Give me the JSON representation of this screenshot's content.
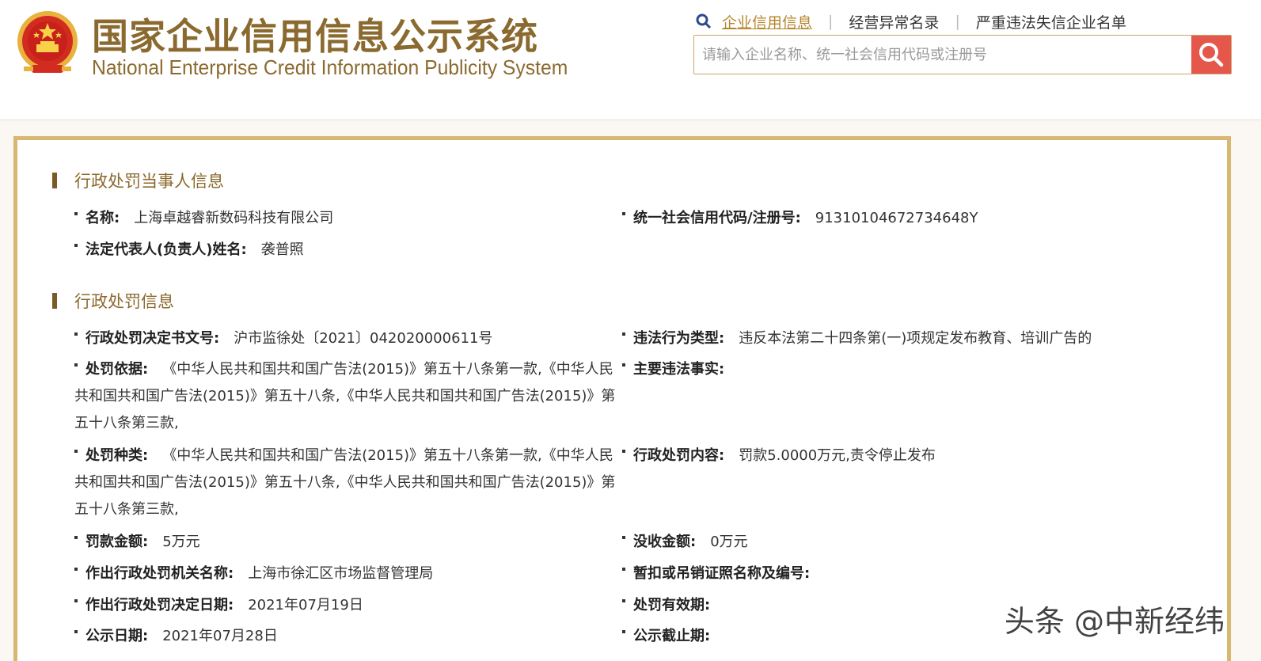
{
  "header": {
    "title_cn": "国家企业信用信息公示系统",
    "title_en": "National Enterprise Credit Information Publicity System",
    "nav": [
      {
        "label": "企业信用信息"
      },
      {
        "label": "经营异常名录"
      },
      {
        "label": "严重违法失信企业名单"
      }
    ],
    "search_placeholder": "请输入企业名称、统一社会信用代码或注册号"
  },
  "party_section": {
    "title": "行政处罚当事人信息",
    "name_label": "名称:",
    "name_value": "上海卓越睿新数码科技有限公司",
    "credit_code_label": "统一社会信用代码/注册号:",
    "credit_code_value": "91310104672734648Y",
    "legal_rep_label": "法定代表人(负责人)姓名:",
    "legal_rep_value": "袭普照"
  },
  "penalty_section": {
    "title": "行政处罚信息",
    "doc_no_label": "行政处罚决定书文号:",
    "doc_no_value": "沪市监徐处〔2021〕042020000611号",
    "violation_type_label": "违法行为类型:",
    "violation_type_value": "违反本法第二十四条第(一)项规定发布教育、培训广告的",
    "basis_label": "处罚依据:",
    "basis_value": "《中华人民共和国共和国广告法(2015)》第五十八条第一款,《中华人民共和国共和国广告法(2015)》第五十八条,《中华人民共和国共和国广告法(2015)》第五十八条第三款,",
    "main_facts_label": "主要违法事实:",
    "main_facts_value": "",
    "penalty_kind_label": "处罚种类:",
    "penalty_kind_value": "《中华人民共和国共和国广告法(2015)》第五十八条第一款,《中华人民共和国共和国广告法(2015)》第五十八条,《中华人民共和国共和国广告法(2015)》第五十八条第三款,",
    "penalty_content_label": "行政处罚内容:",
    "penalty_content_value": "罚款5.0000万元,责令停止发布",
    "fine_label": "罚款金额:",
    "fine_value": "5万元",
    "confiscation_label": "没收金额:",
    "confiscation_value": "0万元",
    "authority_label": "作出行政处罚机关名称:",
    "authority_value": "上海市徐汇区市场监督管理局",
    "license_label": "暂扣或吊销证照名称及编号:",
    "license_value": "",
    "decision_date_label": "作出行政处罚决定日期:",
    "decision_date_value": "2021年07月19日",
    "validity_label": "处罚有效期:",
    "validity_value": "",
    "publish_date_label": "公示日期:",
    "publish_date_value": "2021年07月28日",
    "publish_end_label": "公示截止期:",
    "publish_end_value": ""
  },
  "watermark": "头条 @中新经纬",
  "colors": {
    "brand": "#8b6a2f",
    "border": "#d8b772",
    "search_button": "#e5564b",
    "active_link": "#b5862c"
  }
}
